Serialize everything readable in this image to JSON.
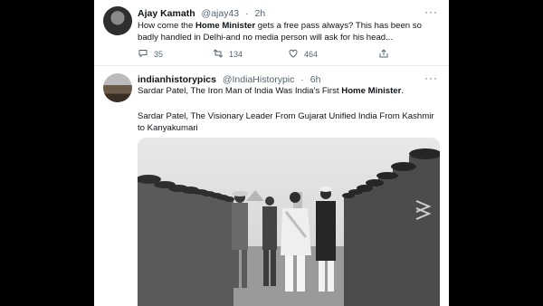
{
  "tweets": [
    {
      "display_name": "Ajay Kamath",
      "handle": "@ajay43",
      "time": "2h",
      "text_before": "How come the ",
      "text_bold": "Home Minister",
      "text_after": " gets a free pass always? This has been so badly handled in Delhi-and no media person will ask for his head...",
      "actions": {
        "replies": "35",
        "retweets": "134",
        "likes": "464"
      }
    },
    {
      "display_name": "indianhistorypics",
      "handle": "@IndiaHistorypic",
      "time": "6h",
      "line1_before": "Sardar Patel, The Iron Man of India Was India's First ",
      "line1_bold": "Home Minister",
      "line1_after": ".",
      "line2": "Sardar Patel, The Visionary Leader From Gujarat  Unified India From Kashmir to Kanyakumari"
    }
  ],
  "icons": [
    "reply-icon",
    "retweet-icon",
    "like-icon",
    "share-icon",
    "more-icon"
  ],
  "colors": {
    "text": "#0f1419",
    "muted": "#536471",
    "background": "#000000",
    "panel": "#ffffff"
  }
}
